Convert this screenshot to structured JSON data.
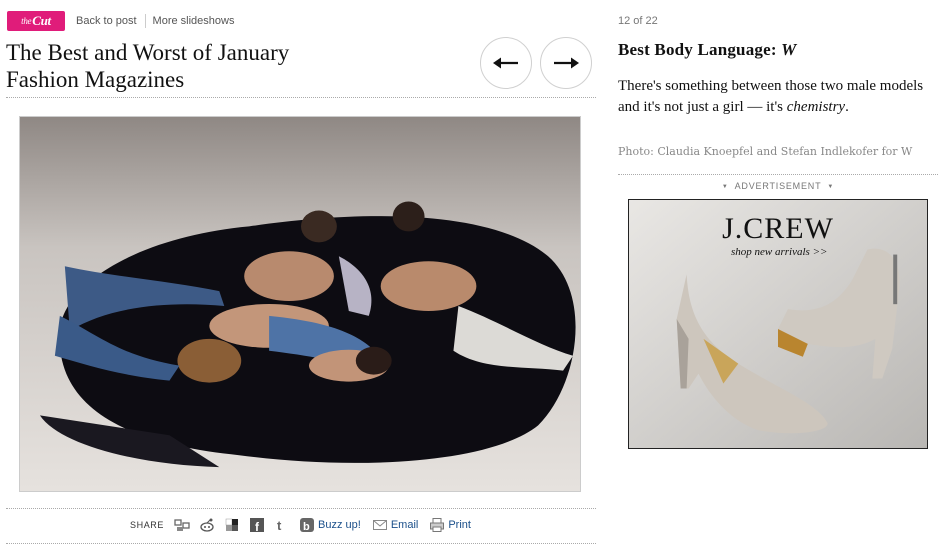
{
  "header": {
    "logo_prefix": "the",
    "logo_text": "Cut",
    "back_link": "Back to post",
    "more_link": "More slideshows"
  },
  "slideshow": {
    "title_line1": "The Best and Worst of January",
    "title_line2": "Fashion Magazines",
    "counter": "12 of 22",
    "prev_icon": "arrow-left-icon",
    "next_icon": "arrow-right-icon"
  },
  "caption": {
    "heading": "Best Body Language:",
    "heading_pub": "W",
    "text_before": "There's something between those two male models and it's not just a girl — it's",
    "text_em": "chemistry",
    "text_after": ".",
    "credit": "Photo: Claudia Knoepfel and Stefan Indlekofer for W"
  },
  "share": {
    "label": "SHARE",
    "icons": [
      "digg-icon",
      "reddit-icon",
      "delicious-icon",
      "facebook-icon",
      "twitter-icon"
    ],
    "buzz": "Buzz up!",
    "email": "Email",
    "print": "Print"
  },
  "advertisement": {
    "label": "ADVERTISEMENT",
    "brand": "J.CREW",
    "tagline": "shop new arrivals >>"
  },
  "colors": {
    "logo_pink": "#e01c7a",
    "link_blue": "#1a4f8a"
  }
}
